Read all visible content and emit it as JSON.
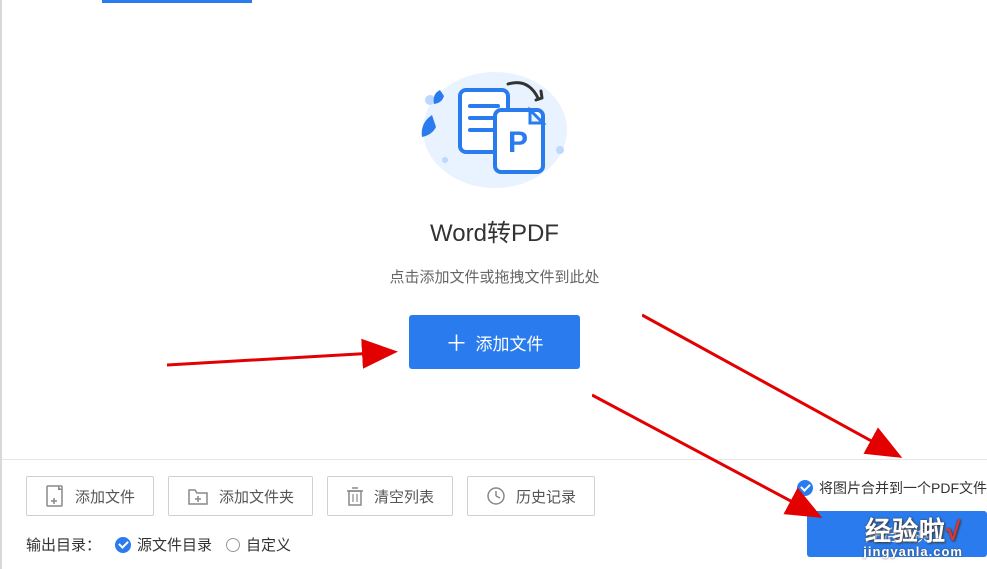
{
  "main": {
    "title": "Word转PDF",
    "subtitle": "点击添加文件或拖拽文件到此处",
    "add_button": "添加文件"
  },
  "toolbar": {
    "add_file": "添加文件",
    "add_folder": "添加文件夹",
    "clear_list": "清空列表",
    "history": "历史记录"
  },
  "options": {
    "merge_images": "将图片合并到一个PDF文件",
    "output_label": "输出目录：",
    "source_dir": "源文件目录",
    "custom": "自定义"
  },
  "convert_button": "开始转换",
  "watermark": {
    "line1_pre": "经验啦",
    "line1_mark": "√",
    "line2": "jingyanla.com"
  }
}
